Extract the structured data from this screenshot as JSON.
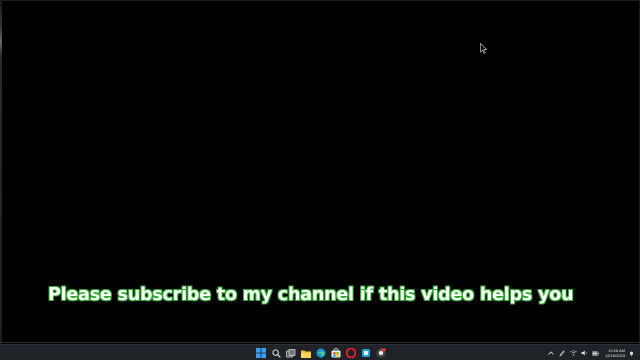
{
  "video": {
    "caption": "Please subscribe to my channel if this video helps you"
  },
  "colors": {
    "background": "#000000",
    "caption_text": "#fefefe",
    "caption_outline": "#2fa82f",
    "taskbar": "#1f2328"
  },
  "taskbar": {
    "icons": [
      "windows-start-icon",
      "search-icon",
      "task-view-icon",
      "file-explorer-icon",
      "edge-icon",
      "store-icon",
      "opera-icon",
      "tool-icon",
      "chrome-icon"
    ],
    "tray_icons": [
      "chevron-up-icon",
      "pen-icon",
      "wifi-icon",
      "volume-icon",
      "battery-icon"
    ],
    "clock": {
      "time": "10:26 AM",
      "date": "12/16/2023"
    }
  }
}
